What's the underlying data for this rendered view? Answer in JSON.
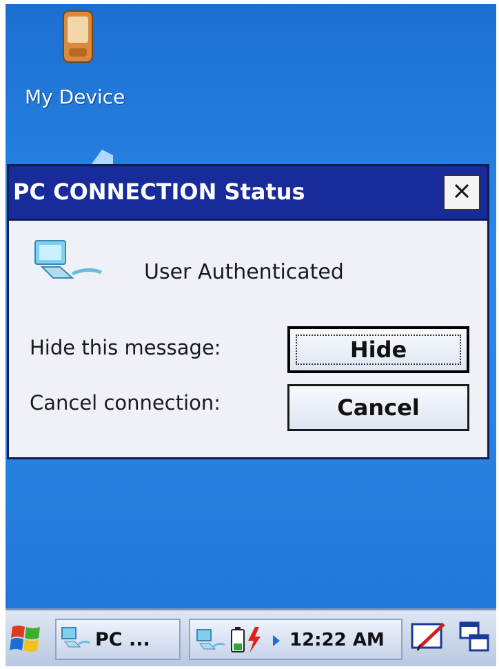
{
  "desktop": {
    "icons": [
      {
        "label": "My Device",
        "icon": "pda-device-icon"
      }
    ]
  },
  "dialog": {
    "title": "PC CONNECTION Status",
    "close_label": "×",
    "status_text": "User Authenticated",
    "status_icon": "network-computer-icon",
    "rows": [
      {
        "label": "Hide this message:",
        "button": "Hide"
      },
      {
        "label": "Cancel connection:",
        "button": "Cancel"
      }
    ]
  },
  "taskbar": {
    "start_icon": "windows-flag-icon",
    "task_button_label": "PC ...",
    "tray_icons": [
      "network-connection-icon",
      "battery-charging-icon",
      "tray-expand-arrow-icon"
    ],
    "clock": "12:22 AM",
    "input_panel_icon": "input-panel-icon",
    "switch_windows_icon": "switch-windows-icon"
  },
  "colors": {
    "desktop_blue": "#2a86e6",
    "titlebar_blue": "#172b9a",
    "dialog_bg": "#eef2f8"
  }
}
